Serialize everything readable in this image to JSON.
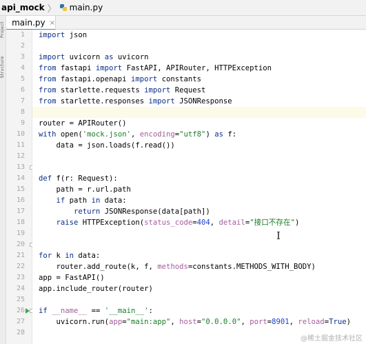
{
  "breadcrumb": {
    "project": "api_mock",
    "file": "main.py"
  },
  "side_labels": [
    "Project",
    "Structure"
  ],
  "tab": {
    "label": "main.py",
    "close": "×"
  },
  "editor": {
    "lines": [
      [
        [
          "import",
          "kw"
        ],
        [
          " json",
          ""
        ]
      ],
      [],
      [
        [
          "import",
          "kw"
        ],
        [
          " uvicorn ",
          ""
        ],
        [
          "as",
          "kw"
        ],
        [
          " uvicorn",
          ""
        ]
      ],
      [
        [
          "from",
          "kw"
        ],
        [
          " fastapi ",
          ""
        ],
        [
          "import",
          "kw"
        ],
        [
          " FastAPI, APIRouter, HTTPException",
          ""
        ]
      ],
      [
        [
          "from",
          "kw"
        ],
        [
          " fastapi.openapi ",
          ""
        ],
        [
          "import",
          "kw"
        ],
        [
          " constants",
          ""
        ]
      ],
      [
        [
          "from",
          "kw"
        ],
        [
          " starlette.requests ",
          ""
        ],
        [
          "import",
          "kw"
        ],
        [
          " Request",
          ""
        ]
      ],
      [
        [
          "from",
          "kw"
        ],
        [
          " starlette.responses ",
          ""
        ],
        [
          "import",
          "kw"
        ],
        [
          " JSONResponse",
          ""
        ]
      ],
      [],
      [
        [
          "router = APIRouter()",
          ""
        ]
      ],
      [
        [
          "with",
          "kw"
        ],
        [
          " open(",
          ""
        ],
        [
          "'mock.json'",
          "str"
        ],
        [
          ", ",
          ""
        ],
        [
          "encoding",
          "kwarg"
        ],
        [
          "=",
          ""
        ],
        [
          "\"utf8\"",
          "str"
        ],
        [
          ") ",
          ""
        ],
        [
          "as",
          "kw"
        ],
        [
          " f:",
          ""
        ]
      ],
      [
        [
          "    data = json.loads(f.read())",
          ""
        ]
      ],
      [],
      [],
      [
        [
          "def",
          "kw"
        ],
        [
          " f(r: Request):",
          ""
        ]
      ],
      [
        [
          "    path = r.url.path",
          ""
        ]
      ],
      [
        [
          "    ",
          ""
        ],
        [
          "if",
          "kw"
        ],
        [
          " path ",
          ""
        ],
        [
          "in",
          "kw"
        ],
        [
          " data:",
          ""
        ]
      ],
      [
        [
          "        ",
          ""
        ],
        [
          "return",
          "kw"
        ],
        [
          " JSONResponse(data[path])",
          ""
        ]
      ],
      [
        [
          "    ",
          ""
        ],
        [
          "raise",
          "kw"
        ],
        [
          " HTTPException(",
          ""
        ],
        [
          "status_code",
          "kwarg"
        ],
        [
          "=",
          ""
        ],
        [
          "404",
          "num"
        ],
        [
          ", ",
          ""
        ],
        [
          "detail",
          "kwarg"
        ],
        [
          "=",
          ""
        ],
        [
          "\"接口不存在\"",
          "str"
        ],
        [
          ")",
          ""
        ]
      ],
      [],
      [],
      [
        [
          "for",
          "kw"
        ],
        [
          " k ",
          ""
        ],
        [
          "in",
          "kw"
        ],
        [
          " data:",
          ""
        ]
      ],
      [
        [
          "    router.add_route(k, f, ",
          ""
        ],
        [
          "methods",
          "kwarg"
        ],
        [
          "=constants.METHODS_WITH_BODY)",
          ""
        ]
      ],
      [
        [
          "app = FastAPI()",
          ""
        ]
      ],
      [
        [
          "app.include_router(router)",
          ""
        ]
      ],
      [],
      [
        [
          "if",
          "kw"
        ],
        [
          " ",
          ""
        ],
        [
          "__name__",
          "dunder"
        ],
        [
          " == ",
          ""
        ],
        [
          "'__main__'",
          "str"
        ],
        [
          ":",
          ""
        ]
      ],
      [
        [
          "    uvicorn.run(",
          ""
        ],
        [
          "app",
          "kwarg"
        ],
        [
          "=",
          ""
        ],
        [
          "\"main:app\"",
          "str"
        ],
        [
          ", ",
          ""
        ],
        [
          "host",
          "kwarg"
        ],
        [
          "=",
          ""
        ],
        [
          "\"0.0.0.0\"",
          "str"
        ],
        [
          ", ",
          ""
        ],
        [
          "port",
          "kwarg"
        ],
        [
          "=",
          ""
        ],
        [
          "8901",
          "num"
        ],
        [
          ", ",
          ""
        ],
        [
          "reload",
          "kwarg"
        ],
        [
          "=",
          ""
        ],
        [
          "True",
          "kw"
        ],
        [
          ")",
          ""
        ]
      ],
      []
    ],
    "current_line": 8,
    "run_line": 26,
    "fold_lines": [
      13,
      20,
      26
    ]
  },
  "watermark": "@稀土掘金技术社区"
}
